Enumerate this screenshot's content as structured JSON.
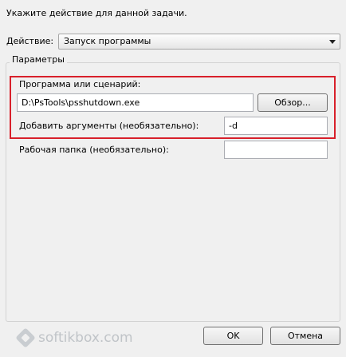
{
  "dialog": {
    "heading": "Укажите действие для данной задачи."
  },
  "action": {
    "label": "Действие:",
    "selected": "Запуск программы"
  },
  "parameters": {
    "title": "Параметры",
    "program_label": "Программа или сценарий:",
    "program_value": "D:\\PsTools\\psshutdown.exe",
    "browse_label": "Обзор...",
    "args_label": "Добавить аргументы (необязательно):",
    "args_value": "-d",
    "workdir_label": "Рабочая папка (необязательно):",
    "workdir_value": ""
  },
  "buttons": {
    "ok": "OK",
    "cancel": "Отмена"
  },
  "watermark": {
    "text": "softikbox.com"
  },
  "colors": {
    "highlight": "#d8202b"
  }
}
